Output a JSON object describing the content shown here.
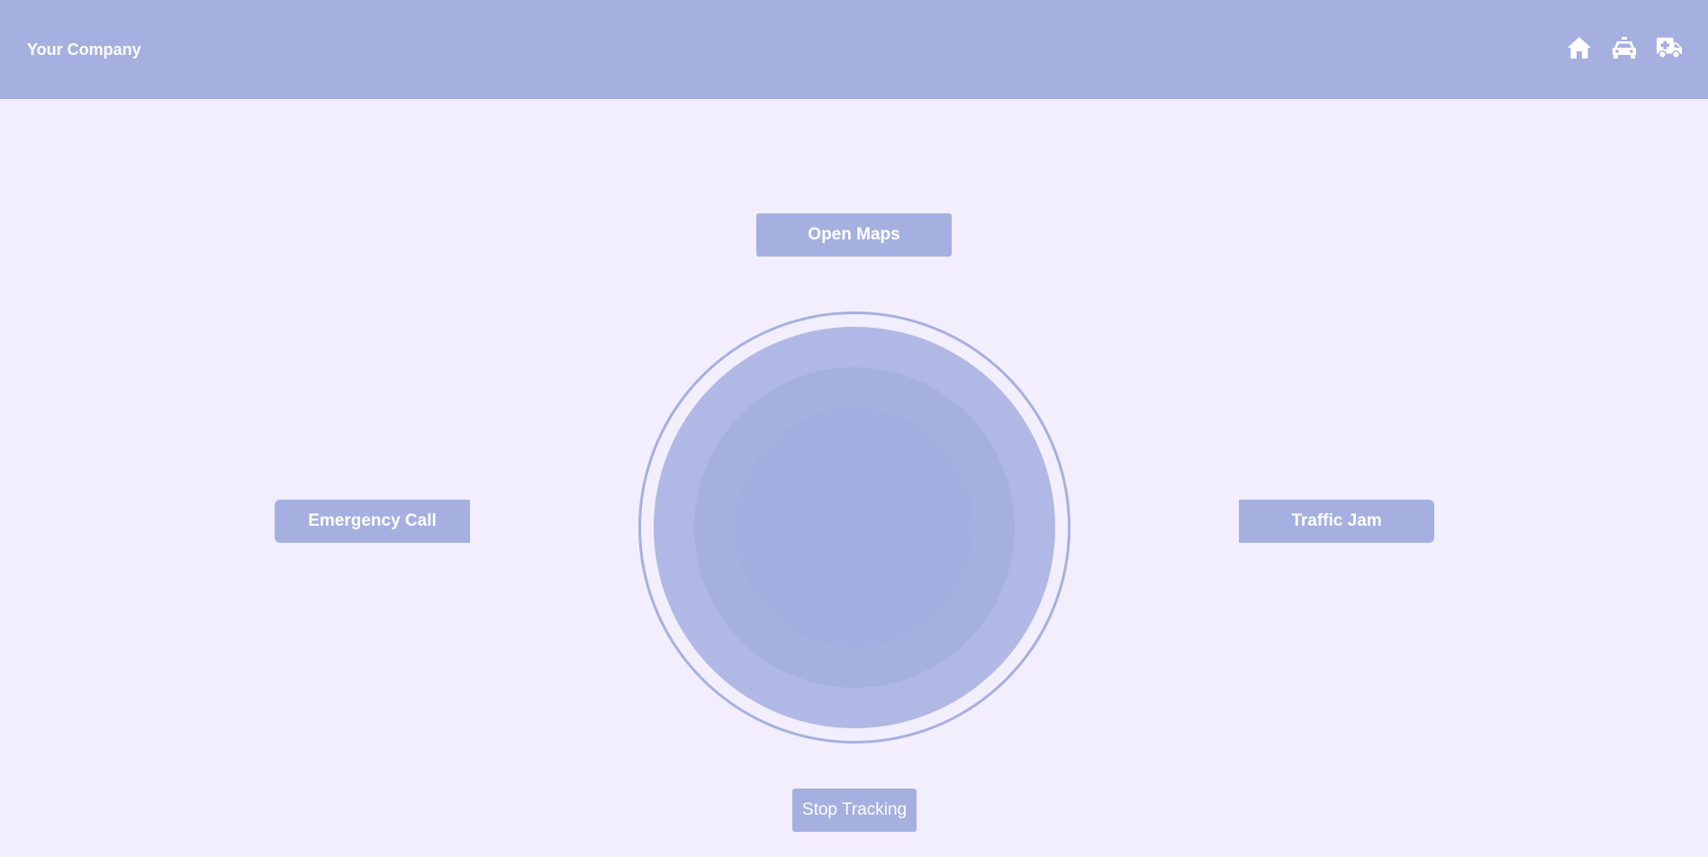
{
  "header": {
    "brand": "Your Company",
    "icons": [
      {
        "name": "home-icon"
      },
      {
        "name": "car-icon"
      },
      {
        "name": "ambulance-icon"
      }
    ]
  },
  "actions": {
    "open_maps": "Open Maps",
    "emergency_call": "Emergency Call",
    "traffic_jam": "Traffic Jam",
    "stop_tracking": "Stop Tracking"
  },
  "colors": {
    "accent": "#a5b0e0",
    "background": "#f3eefd",
    "text_on_accent": "#ffffff"
  }
}
